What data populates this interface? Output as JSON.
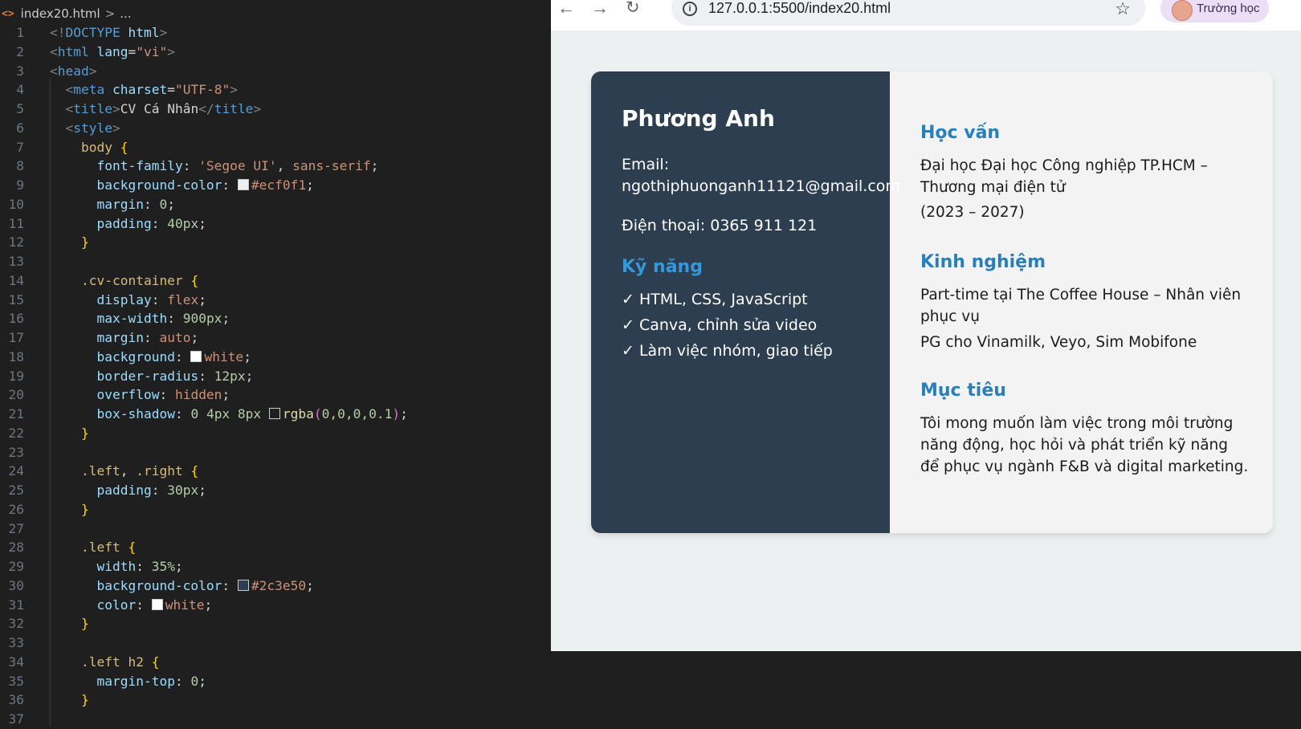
{
  "editor": {
    "breadcrumb": {
      "icon": "<>",
      "file": "index20.html",
      "sep": ">",
      "more": "..."
    },
    "line_numbers": [
      "1",
      "2",
      "3",
      "4",
      "5",
      "6",
      "7",
      "8",
      "9",
      "10",
      "11",
      "12",
      "13",
      "14",
      "15",
      "16",
      "17",
      "18",
      "19",
      "20",
      "21",
      "22",
      "23",
      "24",
      "25",
      "26",
      "27",
      "28",
      "29",
      "30",
      "31",
      "32",
      "33",
      "34",
      "35",
      "36",
      "37"
    ],
    "lines": [
      [
        [
          "punc",
          "<!"
        ],
        [
          "tag",
          "DOCTYPE"
        ],
        [
          "text",
          " "
        ],
        [
          "attr",
          "html"
        ],
        [
          "punc",
          ">"
        ]
      ],
      [
        [
          "punc",
          "<"
        ],
        [
          "tag",
          "html"
        ],
        [
          "text",
          " "
        ],
        [
          "attr",
          "lang"
        ],
        [
          "text",
          "="
        ],
        [
          "str",
          "\"vi\""
        ],
        [
          "punc",
          ">"
        ]
      ],
      [
        [
          "punc",
          "<"
        ],
        [
          "tag",
          "head"
        ],
        [
          "punc",
          ">"
        ]
      ],
      [
        [
          "text",
          "  "
        ],
        [
          "punc",
          "<"
        ],
        [
          "tag",
          "meta"
        ],
        [
          "text",
          " "
        ],
        [
          "attr",
          "charset"
        ],
        [
          "text",
          "="
        ],
        [
          "str",
          "\"UTF-8\""
        ],
        [
          "punc",
          ">"
        ]
      ],
      [
        [
          "text",
          "  "
        ],
        [
          "punc",
          "<"
        ],
        [
          "tag",
          "title"
        ],
        [
          "punc",
          ">"
        ],
        [
          "text",
          "CV Cá Nhân"
        ],
        [
          "punc",
          "</"
        ],
        [
          "tag",
          "title"
        ],
        [
          "punc",
          ">"
        ]
      ],
      [
        [
          "text",
          "  "
        ],
        [
          "punc",
          "<"
        ],
        [
          "tag",
          "style"
        ],
        [
          "punc",
          ">"
        ]
      ],
      [
        [
          "text",
          "    "
        ],
        [
          "sel",
          "body"
        ],
        [
          "text",
          " "
        ],
        [
          "brace",
          "{"
        ]
      ],
      [
        [
          "text",
          "      "
        ],
        [
          "prop",
          "font-family"
        ],
        [
          "def",
          ": "
        ],
        [
          "val",
          "'Segoe UI'"
        ],
        [
          "def",
          ", "
        ],
        [
          "val",
          "sans-serif"
        ],
        [
          "def",
          ";"
        ]
      ],
      [
        [
          "text",
          "      "
        ],
        [
          "prop",
          "background-color"
        ],
        [
          "def",
          ": "
        ],
        [
          "swatch",
          "#ecf0f1"
        ],
        [
          "val",
          "#ecf0f1"
        ],
        [
          "def",
          ";"
        ]
      ],
      [
        [
          "text",
          "      "
        ],
        [
          "prop",
          "margin"
        ],
        [
          "def",
          ": "
        ],
        [
          "num",
          "0"
        ],
        [
          "def",
          ";"
        ]
      ],
      [
        [
          "text",
          "      "
        ],
        [
          "prop",
          "padding"
        ],
        [
          "def",
          ": "
        ],
        [
          "num",
          "40px"
        ],
        [
          "def",
          ";"
        ]
      ],
      [
        [
          "text",
          "    "
        ],
        [
          "brace",
          "}"
        ]
      ],
      [],
      [
        [
          "text",
          "    "
        ],
        [
          "sel",
          ".cv-container"
        ],
        [
          "text",
          " "
        ],
        [
          "brace",
          "{"
        ]
      ],
      [
        [
          "text",
          "      "
        ],
        [
          "prop",
          "display"
        ],
        [
          "def",
          ": "
        ],
        [
          "val",
          "flex"
        ],
        [
          "def",
          ";"
        ]
      ],
      [
        [
          "text",
          "      "
        ],
        [
          "prop",
          "max-width"
        ],
        [
          "def",
          ": "
        ],
        [
          "num",
          "900px"
        ],
        [
          "def",
          ";"
        ]
      ],
      [
        [
          "text",
          "      "
        ],
        [
          "prop",
          "margin"
        ],
        [
          "def",
          ": "
        ],
        [
          "val",
          "auto"
        ],
        [
          "def",
          ";"
        ]
      ],
      [
        [
          "text",
          "      "
        ],
        [
          "prop",
          "background"
        ],
        [
          "def",
          ": "
        ],
        [
          "swatch",
          "#ffffff"
        ],
        [
          "val",
          "white"
        ],
        [
          "def",
          ";"
        ]
      ],
      [
        [
          "text",
          "      "
        ],
        [
          "prop",
          "border-radius"
        ],
        [
          "def",
          ": "
        ],
        [
          "num",
          "12px"
        ],
        [
          "def",
          ";"
        ]
      ],
      [
        [
          "text",
          "      "
        ],
        [
          "prop",
          "overflow"
        ],
        [
          "def",
          ": "
        ],
        [
          "val",
          "hidden"
        ],
        [
          "def",
          ";"
        ]
      ],
      [
        [
          "text",
          "      "
        ],
        [
          "prop",
          "box-shadow"
        ],
        [
          "def",
          ": "
        ],
        [
          "num",
          "0 4px 8px"
        ],
        [
          "def",
          " "
        ],
        [
          "swatch",
          "transparent"
        ],
        [
          "fn",
          "rgba"
        ],
        [
          "par",
          "("
        ],
        [
          "num",
          "0,0,0,0.1"
        ],
        [
          "par",
          ")"
        ],
        [
          "def",
          ";"
        ]
      ],
      [
        [
          "text",
          "    "
        ],
        [
          "brace",
          "}"
        ]
      ],
      [],
      [
        [
          "text",
          "    "
        ],
        [
          "sel",
          ".left"
        ],
        [
          "def",
          ", "
        ],
        [
          "sel",
          ".right"
        ],
        [
          "text",
          " "
        ],
        [
          "brace",
          "{"
        ]
      ],
      [
        [
          "text",
          "      "
        ],
        [
          "prop",
          "padding"
        ],
        [
          "def",
          ": "
        ],
        [
          "num",
          "30px"
        ],
        [
          "def",
          ";"
        ]
      ],
      [
        [
          "text",
          "    "
        ],
        [
          "brace",
          "}"
        ]
      ],
      [],
      [
        [
          "text",
          "    "
        ],
        [
          "sel",
          ".left"
        ],
        [
          "text",
          " "
        ],
        [
          "brace",
          "{"
        ]
      ],
      [
        [
          "text",
          "      "
        ],
        [
          "prop",
          "width"
        ],
        [
          "def",
          ": "
        ],
        [
          "num",
          "35%"
        ],
        [
          "def",
          ";"
        ]
      ],
      [
        [
          "text",
          "      "
        ],
        [
          "prop",
          "background-color"
        ],
        [
          "def",
          ": "
        ],
        [
          "swatch",
          "#2c3e50"
        ],
        [
          "val",
          "#2c3e50"
        ],
        [
          "def",
          ";"
        ]
      ],
      [
        [
          "text",
          "      "
        ],
        [
          "prop",
          "color"
        ],
        [
          "def",
          ": "
        ],
        [
          "swatch",
          "#ffffff"
        ],
        [
          "val",
          "white"
        ],
        [
          "def",
          ";"
        ]
      ],
      [
        [
          "text",
          "    "
        ],
        [
          "brace",
          "}"
        ]
      ],
      [],
      [
        [
          "text",
          "    "
        ],
        [
          "sel",
          ".left h2"
        ],
        [
          "text",
          " "
        ],
        [
          "brace",
          "{"
        ]
      ],
      [
        [
          "text",
          "      "
        ],
        [
          "prop",
          "margin-top"
        ],
        [
          "def",
          ": "
        ],
        [
          "num",
          "0"
        ],
        [
          "def",
          ";"
        ]
      ],
      [
        [
          "text",
          "    "
        ],
        [
          "brace",
          "}"
        ]
      ],
      []
    ]
  },
  "browser": {
    "back_icon": "←",
    "forward_icon": "→",
    "reload_icon": "↻",
    "url": "127.0.0.1:5500/index20.html",
    "star_icon": "☆",
    "profile_label": "Trường học"
  },
  "cv": {
    "name": "Phương Anh",
    "email_label": "Email:",
    "email": "ngothiphuonganh11121@gmail.com",
    "phone": "Điện thoại: 0365 911 121",
    "skills_title": "Kỹ năng",
    "skills": [
      "✓ HTML, CSS, JavaScript",
      "✓ Canva, chỉnh sửa video",
      "✓ Làm việc nhóm, giao tiếp"
    ],
    "education_title": "Học vấn",
    "education_text": "Đại học Đại học Công nghiệp TP.HCM – Thương mại điện tử",
    "education_years": "(2023 – 2027)",
    "experience_title": "Kinh nghiệm",
    "experience_1": "Part-time tại The Coffee House – Nhân viên phục vụ",
    "experience_2": "PG cho Vinamilk, Veyo, Sim Mobifone",
    "goal_title": "Mục tiêu",
    "goal_text": "Tôi mong muốn làm việc trong môi trường năng động, học hỏi và phát triển kỹ năng để phục vụ ngành F&B và digital marketing.",
    "colors": {
      "left_bg": "#2c3e50",
      "page_bg": "#ecf0f1",
      "accent": "#3498db"
    }
  }
}
